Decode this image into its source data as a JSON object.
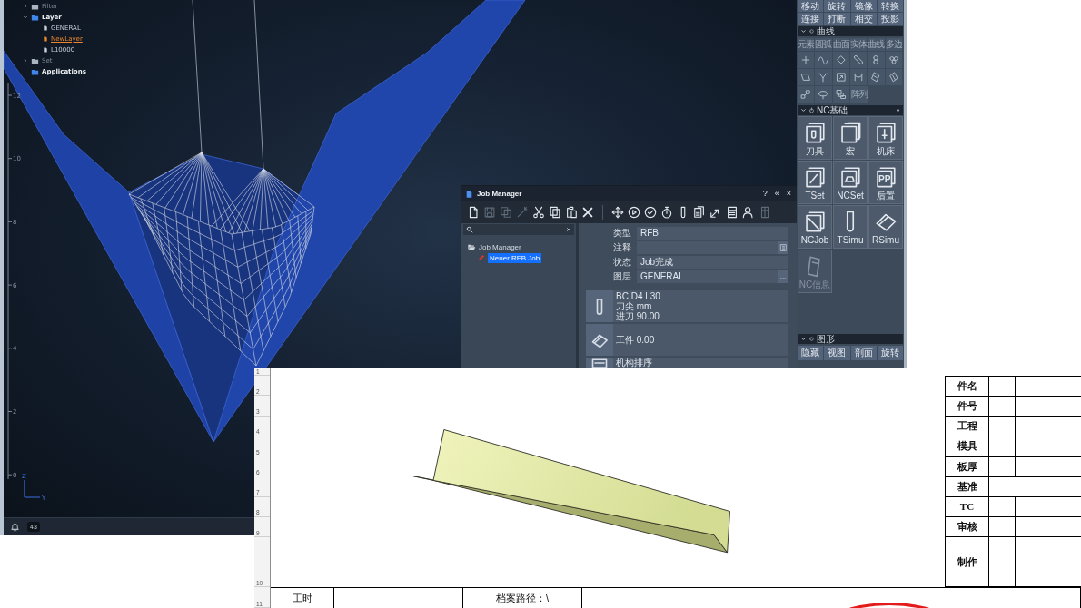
{
  "viewport": {
    "tree": [
      {
        "label": "Filter",
        "expanded": false
      },
      {
        "label": "Layer",
        "expanded": true,
        "children": [
          {
            "label": "GENERAL",
            "active": false
          },
          {
            "label": "NewLayer",
            "active": true
          },
          {
            "label": "L10000",
            "active": false
          }
        ]
      },
      {
        "label": "Set",
        "expanded": false
      },
      {
        "label": "Applications"
      }
    ],
    "scale_labels": [
      "12",
      "10",
      "8",
      "6",
      "4",
      "2",
      "0"
    ],
    "axis_labels": [
      "Z",
      "Y"
    ]
  },
  "status_bar": {
    "badge": "43"
  },
  "tool_panel": {
    "transform_buttons": [
      "移动",
      "旋转",
      "镜像",
      "转换",
      "连接",
      "打断",
      "相交",
      "投影"
    ],
    "draw_section": {
      "title": "曲线",
      "categories": [
        "元素",
        "圆弧",
        "曲面",
        "实体",
        "曲线",
        "多边"
      ],
      "text_button": "阵列"
    },
    "nc_section": {
      "title": "NC基础",
      "tiles": [
        {
          "label": "刀具",
          "disabled": false
        },
        {
          "label": "宏",
          "disabled": false
        },
        {
          "label": "机床",
          "disabled": false
        },
        {
          "label": "TSet",
          "disabled": false
        },
        {
          "label": "NCSet",
          "disabled": false
        },
        {
          "label": "后置",
          "icon_text": "PP",
          "disabled": false
        },
        {
          "label": "NCJob",
          "disabled": false
        },
        {
          "label": "TSimu",
          "disabled": false
        },
        {
          "label": "RSimu",
          "disabled": false
        },
        {
          "label": "NC信息",
          "disabled": true
        }
      ]
    },
    "view_section": {
      "title": "图形",
      "buttons": [
        "隐藏",
        "视图",
        "剖面",
        "旋转"
      ]
    }
  },
  "job_manager": {
    "title": "Job Manager",
    "title_buttons": [
      "?",
      "«",
      "×"
    ],
    "toolbar": [
      [
        {
          "disabled": false
        },
        {
          "disabled": true
        },
        {
          "disabled": true
        },
        {
          "disabled": true
        },
        {
          "disabled": false
        },
        {
          "disabled": false
        },
        {
          "disabled": false
        },
        {
          "disabled": false
        }
      ],
      [
        {
          "disabled": false
        },
        {
          "disabled": false
        },
        {
          "disabled": false
        },
        {
          "disabled": false
        },
        {
          "disabled": false
        },
        {
          "disabled": false
        },
        {
          "disabled": false
        },
        {
          "disabled": false
        },
        {
          "disabled": false
        },
        {
          "disabled": true
        }
      ]
    ],
    "tree": {
      "label": "Job Manager",
      "children": [
        {
          "label": "Neuer RFB Job",
          "selected": true
        }
      ]
    },
    "fields": [
      {
        "label": "类型",
        "kind": "text",
        "value": "RFB"
      },
      {
        "label": "注释",
        "kind": "note"
      },
      {
        "label": "状态",
        "kind": "text",
        "value": "Job完成"
      },
      {
        "label": "图层",
        "kind": "browse",
        "value": "GENERAL",
        "button_label": "..."
      }
    ],
    "cards": [
      {
        "lines": [
          "BC D4 L30",
          "刀尖 mm",
          "进刀 90.00"
        ]
      },
      {
        "lines": [
          "工件 0.00"
        ]
      },
      {
        "lines": [
          "机构排序"
        ]
      }
    ]
  },
  "sheet": {
    "row_numbers": [
      "1",
      "2",
      "3",
      "4",
      "5",
      "6",
      "7",
      "8",
      "9",
      "10",
      "11"
    ],
    "title_block": [
      {
        "label": "件名",
        "kind": "split"
      },
      {
        "label": "件号",
        "kind": "split"
      },
      {
        "label": "工程",
        "kind": "split"
      },
      {
        "label": "模具",
        "kind": "split"
      },
      {
        "label": "板厚",
        "kind": "split"
      },
      {
        "label": "基准",
        "kind": "merged"
      },
      {
        "label": "TC",
        "kind": "split"
      },
      {
        "label": "审核",
        "kind": "split"
      },
      {
        "label": "制作",
        "kind": "split"
      }
    ],
    "footer": [
      {
        "kind": "label",
        "text": "工时"
      },
      {
        "kind": "blank"
      },
      {
        "kind": "blank"
      },
      {
        "kind": "label",
        "text": "档案路径：\\"
      },
      {
        "kind": "blank"
      }
    ]
  }
}
